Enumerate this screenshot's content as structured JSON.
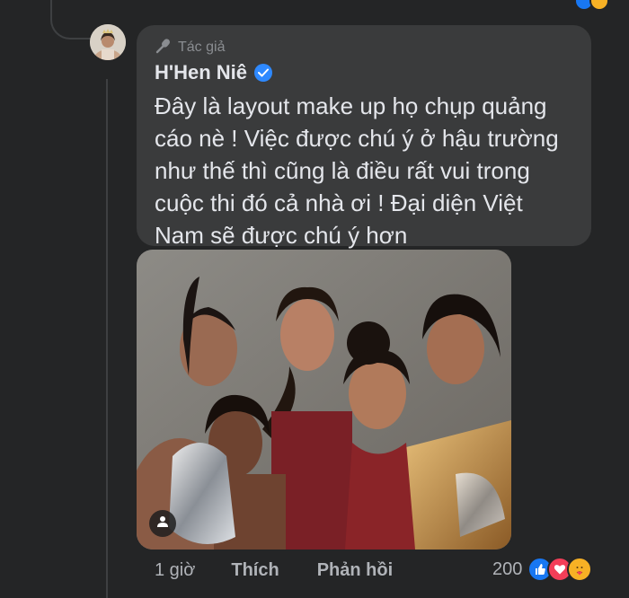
{
  "comment": {
    "author_tag": "Tác giả",
    "author_name": "H'Hen Niê",
    "text": "Đây là layout make up họ chụp quảng cáo nè ! Việc được chú ý ở hậu trường như thế thì cũng là điều rất vui trong cuộc thi đó cả nhà ơi ! Đại diện Việt Nam sẽ được chú ý hơn",
    "time": "1 giờ",
    "like_label": "Thích",
    "reply_label": "Phản hồi",
    "reaction_count": "200",
    "reactions": [
      "like-icon",
      "love-icon",
      "care-icon"
    ]
  },
  "colors": {
    "background": "#242526",
    "bubble": "#3a3b3c",
    "text": "#e4e6eb",
    "muted": "#b0b3b8",
    "verified": "#2e89ff",
    "like": "#1877f2",
    "love": "#f33e58",
    "care": "#f7b125"
  }
}
